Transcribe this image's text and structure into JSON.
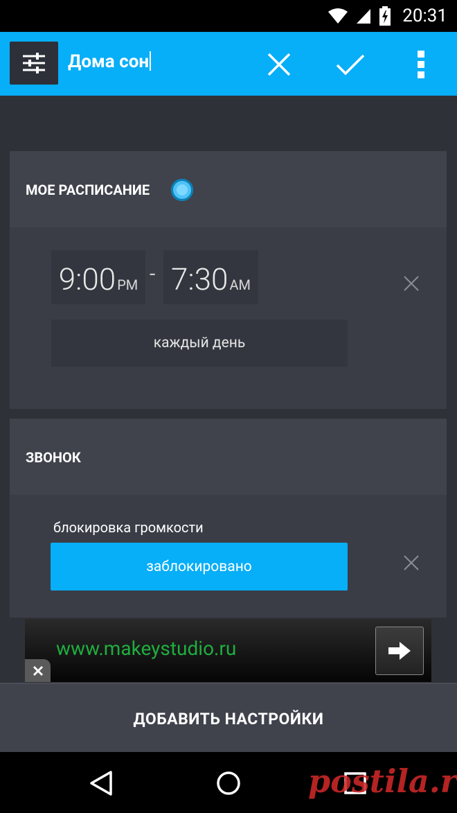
{
  "status_bar": {
    "time": "20:31"
  },
  "toolbar": {
    "title": "Дома сон",
    "menu_icon": "sliders-icon",
    "cancel_icon": "close-icon",
    "confirm_icon": "check-icon",
    "overflow_icon": "more-vert-icon"
  },
  "schedule": {
    "title": "МОЕ РАСПИСАНИЕ",
    "start_time": "9:00",
    "start_ampm": "PM",
    "separator": "-",
    "end_time": "7:30",
    "end_ampm": "AM",
    "days": "каждый день"
  },
  "ringer": {
    "title": "ЗВОНОК",
    "volume_lock_label": "блокировка громкости",
    "volume_lock_value": "заблокировано"
  },
  "ad": {
    "url": "www.makeystudio.ru"
  },
  "add_settings_label": "ДОБАВИТЬ НАСТРОЙКИ",
  "watermark": "postila.ru",
  "colors": {
    "accent": "#07aef8",
    "background": "#2f3138",
    "card": "#3a3d46",
    "card_header": "#40434c",
    "ad_text": "#1fae3e"
  }
}
